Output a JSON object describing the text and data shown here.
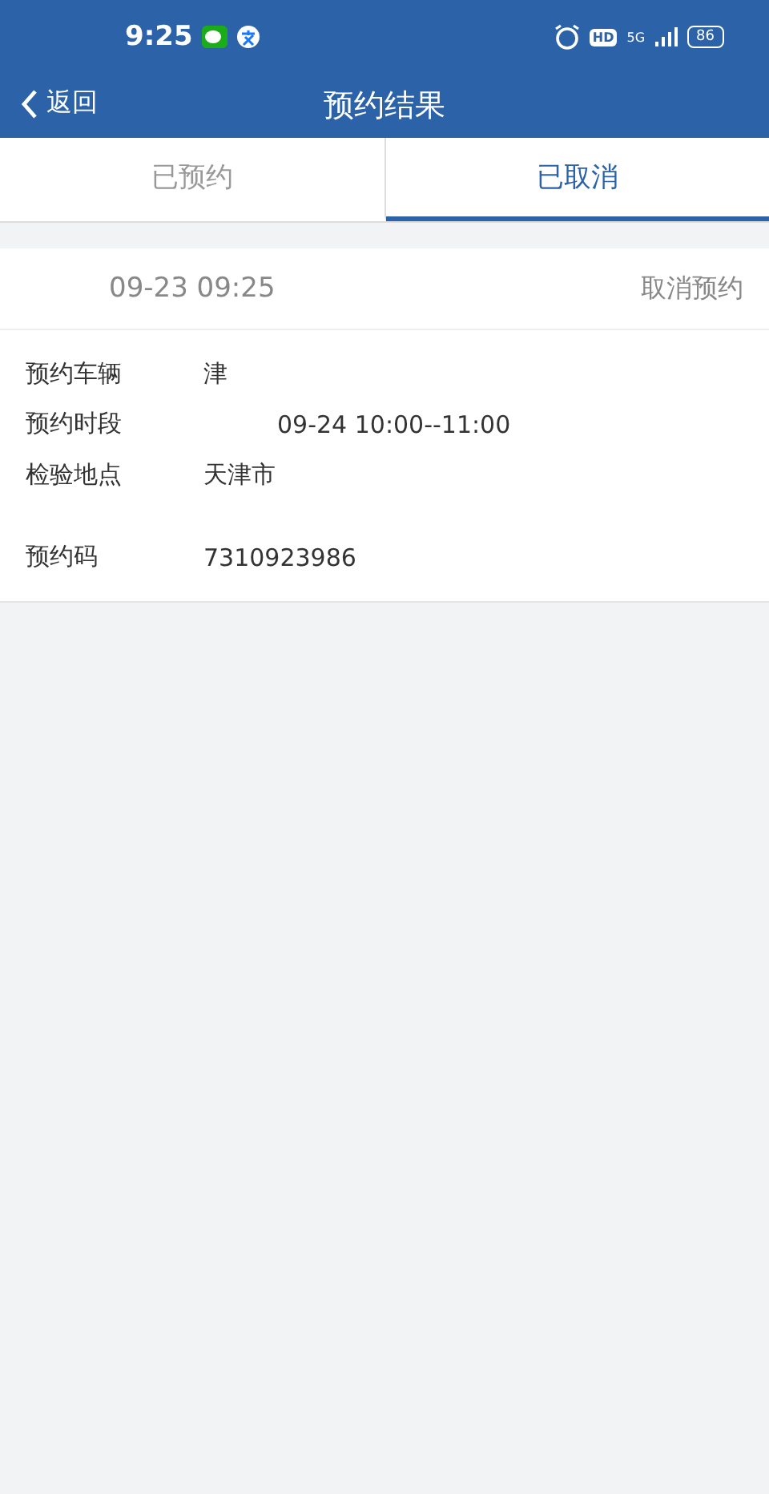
{
  "status_bar": {
    "time": "9:25",
    "hd": "HD",
    "network": "5G",
    "battery": "86"
  },
  "header": {
    "back": "返回",
    "title": "预约结果"
  },
  "tabs": [
    {
      "label": "已预约",
      "selected": false
    },
    {
      "label": "已取消",
      "selected": true
    }
  ],
  "record": {
    "datetime": "09-23 09:25",
    "action": "取消预约",
    "fields": [
      {
        "label": "预约车辆",
        "value": "津"
      },
      {
        "label": "预约时段",
        "value": "09-24 10:00--11:00"
      },
      {
        "label": "检验地点",
        "value": "天津市"
      },
      {
        "label": "预约码",
        "value": "7310923986"
      }
    ]
  }
}
